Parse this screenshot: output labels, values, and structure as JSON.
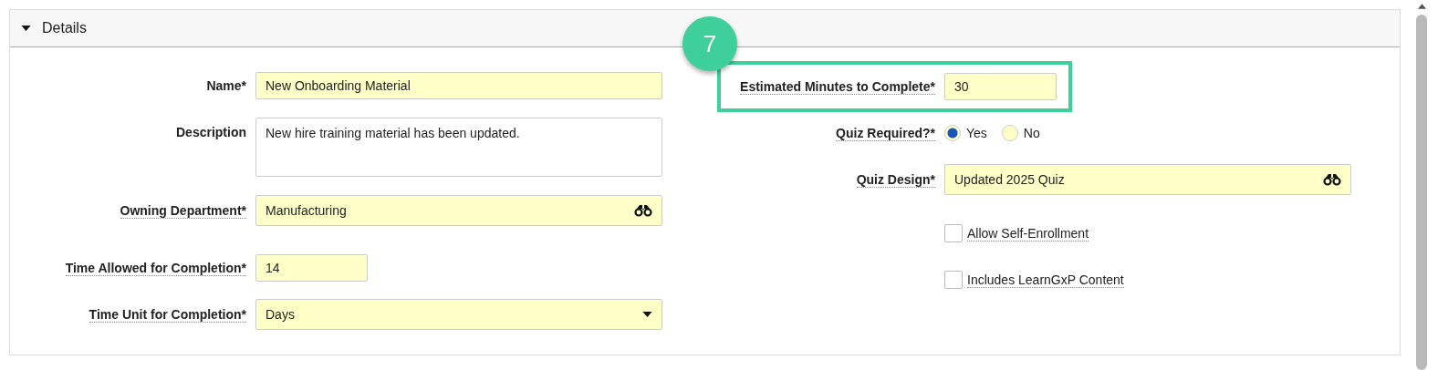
{
  "section": {
    "title": "Details",
    "expanded": true
  },
  "callout": {
    "number": "7"
  },
  "left_fields": [
    {
      "kind": "text",
      "label": "Name*",
      "tooltip": false,
      "required": true,
      "value": "New Onboarding Material"
    },
    {
      "kind": "textarea",
      "label": "Description",
      "tooltip": false,
      "required": false,
      "value": "New hire training material has been updated."
    },
    {
      "kind": "lookup",
      "label": "Owning Department*",
      "tooltip": true,
      "required": true,
      "value": "Manufacturing"
    },
    {
      "kind": "number",
      "label": "Time Allowed for Completion*",
      "tooltip": true,
      "required": true,
      "value": "14"
    },
    {
      "kind": "select",
      "label": "Time Unit for Completion*",
      "tooltip": true,
      "required": true,
      "value": "Days"
    }
  ],
  "right_fields": [
    {
      "kind": "number",
      "label": "Estimated Minutes to Complete*",
      "tooltip": true,
      "required": true,
      "highlighted": true,
      "value": "30"
    },
    {
      "kind": "radio",
      "label": "Quiz Required?*",
      "tooltip": true,
      "options": [
        {
          "label": "Yes",
          "selected": true
        },
        {
          "label": "No",
          "selected": false
        }
      ]
    },
    {
      "kind": "lookup",
      "label": "Quiz Design*",
      "tooltip": true,
      "required": true,
      "value": "Updated 2025 Quiz"
    },
    {
      "kind": "checkbox",
      "label": "Allow Self-Enrollment",
      "checked": false
    },
    {
      "kind": "checkbox",
      "label": "Includes LearnGxP Content",
      "checked": false
    }
  ]
}
